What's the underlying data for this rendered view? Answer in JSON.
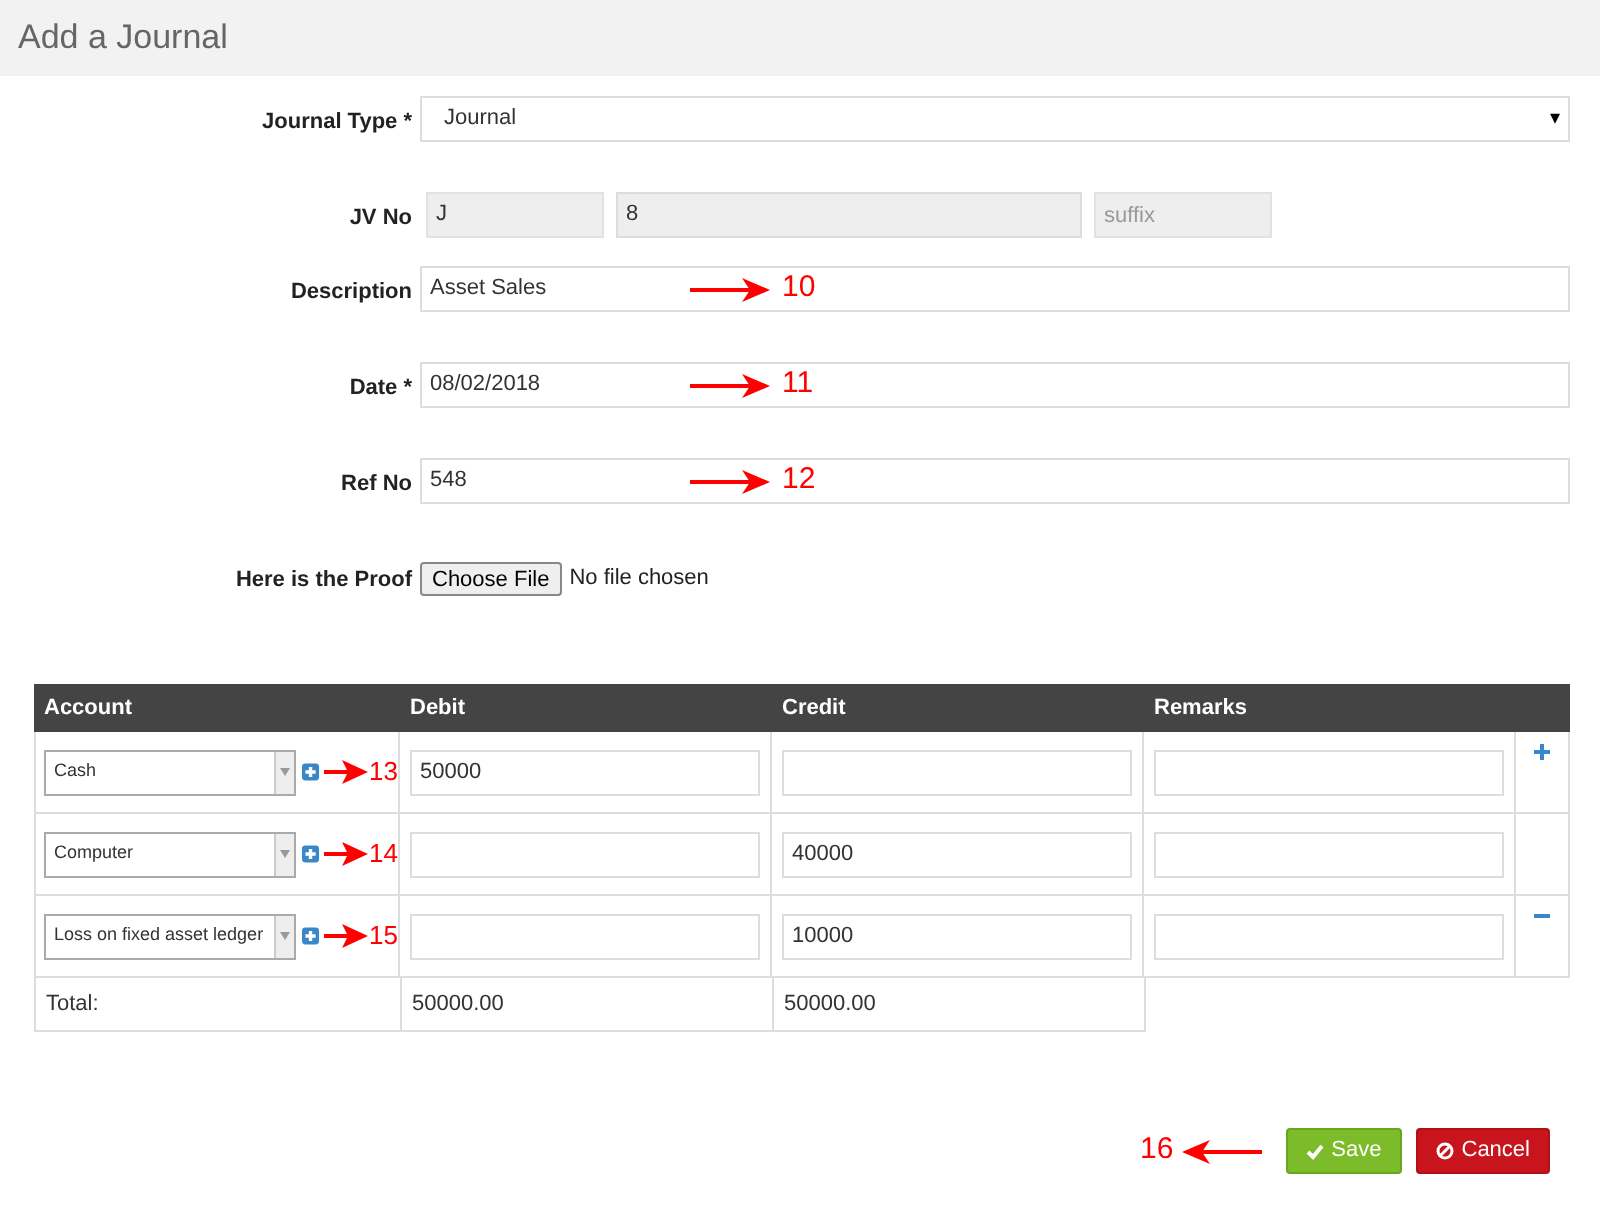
{
  "page_title": "Add a Journal",
  "journal_type": {
    "label": "Journal Type *",
    "value": "Journal",
    "caret": "▾"
  },
  "jv_no": {
    "label": "JV No",
    "prefix": "J",
    "number": "8",
    "suffix_placeholder": "suffix"
  },
  "fields": [
    {
      "label": "Description",
      "value": "Asset Sales",
      "callout": "10"
    },
    {
      "label": "Date *",
      "value": "08/02/2018",
      "callout": "11"
    },
    {
      "label": "Ref No",
      "value": "548",
      "callout": "12"
    }
  ],
  "proof": {
    "label": "Here is the Proof",
    "button": "Choose File",
    "status": "No file chosen"
  },
  "table": {
    "columns": [
      "Account",
      "Debit",
      "Credit",
      "Remarks"
    ],
    "rows": [
      {
        "account": "Cash",
        "debit": "50000",
        "credit": "",
        "remarks": "",
        "callout": "13",
        "kind": "add"
      },
      {
        "account": "Computer",
        "debit": "",
        "credit": "40000",
        "remarks": "",
        "callout": "14",
        "kind": "none"
      },
      {
        "account": "Loss on fixed asset ledger",
        "debit": "",
        "credit": "10000",
        "remarks": "",
        "callout": "15",
        "kind": "remove"
      }
    ],
    "total": {
      "label": "Total:",
      "debit": "50000.00",
      "credit": "50000.00"
    }
  },
  "footer": {
    "callout": "16",
    "save": "Save",
    "cancel": "Cancel"
  }
}
